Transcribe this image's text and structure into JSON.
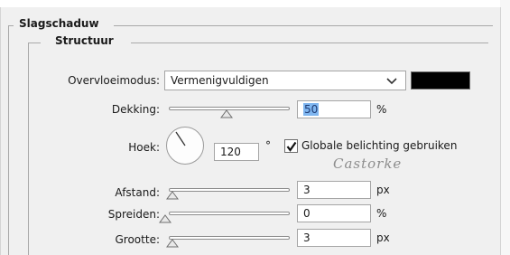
{
  "group_outer": {
    "title": "Slagschaduw"
  },
  "group_inner": {
    "title": "Structuur"
  },
  "blend_mode": {
    "label": "Overvloeimodus:",
    "value": "Vermenigvuldigen",
    "swatch_color": "#000000"
  },
  "opacity": {
    "label": "Dekking:",
    "value": "50",
    "unit": "%",
    "level_percent": 50
  },
  "angle": {
    "label": "Hoek:",
    "value": "120",
    "unit": "°",
    "global_light_label": "Globale belichting gebruiken",
    "global_light_checked": true
  },
  "distance": {
    "label": "Afstand:",
    "value": "3",
    "unit": "px"
  },
  "spread": {
    "label": "Spreiden:",
    "value": "0",
    "unit": "%"
  },
  "size": {
    "label": "Grootte:",
    "value": "3",
    "unit": "px"
  },
  "watermark": {
    "text": "Castorke"
  },
  "colors": {
    "panel": "#f0f0f0",
    "selection": "#7fb6f0"
  }
}
